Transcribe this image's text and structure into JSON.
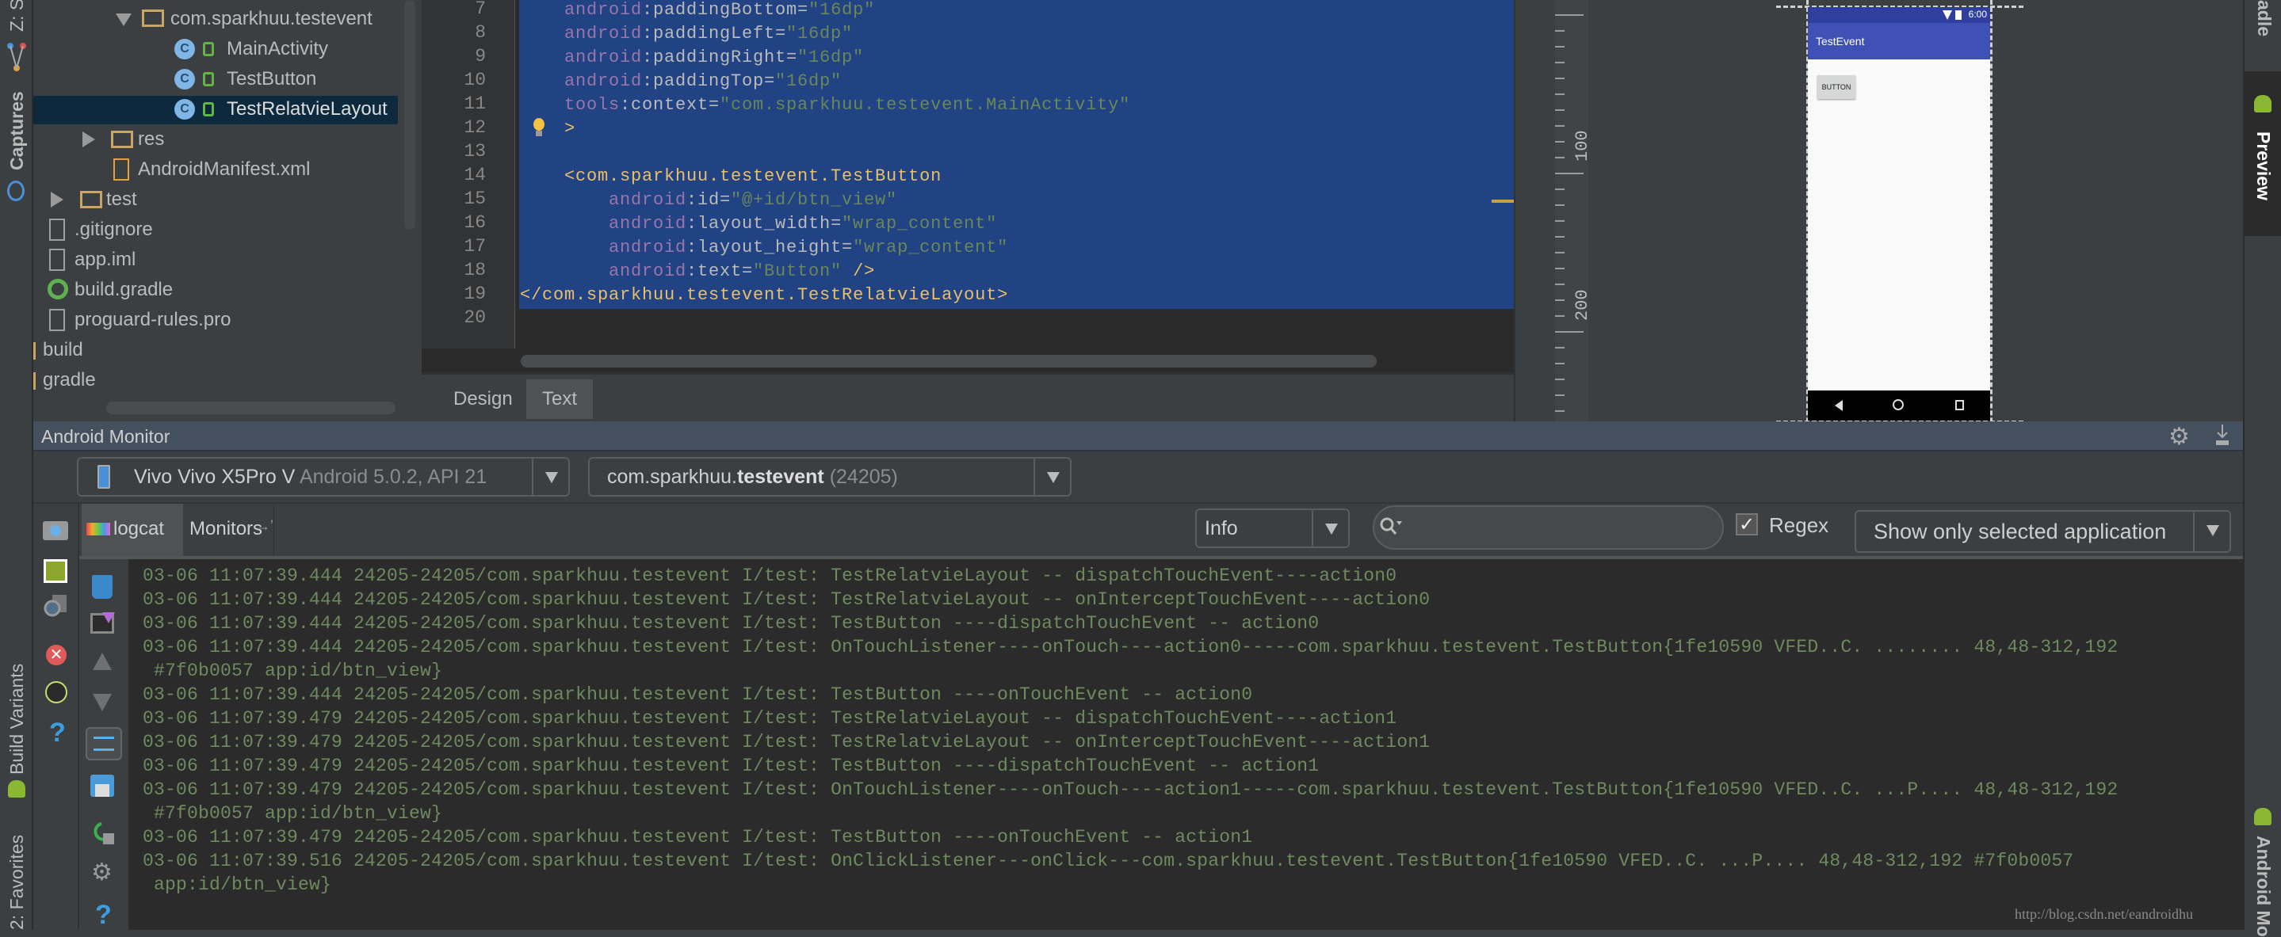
{
  "left_strip": {
    "structure_label": "Z: S",
    "captures_label": "Captures",
    "build_variants_label": "Build Variants",
    "favorites_label": "2: Favorites"
  },
  "project_tree": {
    "items": [
      {
        "label": "com.sparkhuu.testevent",
        "type": "package",
        "expanded": true
      },
      {
        "label": "MainActivity",
        "type": "class"
      },
      {
        "label": "TestButton",
        "type": "class"
      },
      {
        "label": "TestRelatvieLayout",
        "type": "class",
        "selected": true
      },
      {
        "label": "res",
        "type": "folder",
        "expanded": false
      },
      {
        "label": "AndroidManifest.xml",
        "type": "manifest"
      },
      {
        "label": "test",
        "type": "folder",
        "expanded": false
      },
      {
        "label": ".gitignore",
        "type": "file"
      },
      {
        "label": "app.iml",
        "type": "file"
      },
      {
        "label": "build.gradle",
        "type": "gradle"
      },
      {
        "label": "proguard-rules.pro",
        "type": "file"
      },
      {
        "label": "build",
        "type": "folder"
      },
      {
        "label": "gradle",
        "type": "folder"
      }
    ]
  },
  "editor": {
    "lines": [
      {
        "n": "7",
        "indent": 4,
        "parts": [
          [
            "ns",
            "android"
          ],
          [
            "",
            ":paddingBottom="
          ],
          [
            "val",
            "\"16dp\""
          ]
        ]
      },
      {
        "n": "8",
        "indent": 4,
        "parts": [
          [
            "ns",
            "android"
          ],
          [
            "",
            ":paddingLeft="
          ],
          [
            "val",
            "\"16dp\""
          ]
        ]
      },
      {
        "n": "9",
        "indent": 4,
        "parts": [
          [
            "ns",
            "android"
          ],
          [
            "",
            ":paddingRight="
          ],
          [
            "val",
            "\"16dp\""
          ]
        ]
      },
      {
        "n": "10",
        "indent": 4,
        "parts": [
          [
            "ns",
            "android"
          ],
          [
            "",
            ":paddingTop="
          ],
          [
            "val",
            "\"16dp\""
          ]
        ]
      },
      {
        "n": "11",
        "indent": 4,
        "parts": [
          [
            "ns",
            "tools"
          ],
          [
            "",
            ":context="
          ],
          [
            "val",
            "\"com.sparkhuu.testevent.MainActivity\""
          ]
        ]
      },
      {
        "n": "12",
        "indent": 4,
        "parts": [
          [
            "tag",
            ">"
          ]
        ]
      },
      {
        "n": "13",
        "indent": 0,
        "parts": []
      },
      {
        "n": "14",
        "indent": 4,
        "parts": [
          [
            "tag",
            "<com.sparkhuu.testevent.TestButton"
          ]
        ]
      },
      {
        "n": "15",
        "indent": 8,
        "parts": [
          [
            "ns",
            "android"
          ],
          [
            "",
            ":id="
          ],
          [
            "val",
            "\"@+id/btn_view\""
          ]
        ]
      },
      {
        "n": "16",
        "indent": 8,
        "parts": [
          [
            "ns",
            "android"
          ],
          [
            "",
            ":layout_width="
          ],
          [
            "val",
            "\"wrap_content\""
          ]
        ]
      },
      {
        "n": "17",
        "indent": 8,
        "parts": [
          [
            "ns",
            "android"
          ],
          [
            "",
            ":layout_height="
          ],
          [
            "val",
            "\"wrap_content\""
          ]
        ]
      },
      {
        "n": "18",
        "indent": 8,
        "parts": [
          [
            "ns",
            "android"
          ],
          [
            "",
            ":text="
          ],
          [
            "val",
            "\"Button\""
          ],
          [
            "tag",
            " />"
          ]
        ]
      },
      {
        "n": "19",
        "indent": 0,
        "parts": [
          [
            "tag",
            "</com.sparkhuu.testevent.TestRelatvieLayout>"
          ]
        ]
      },
      {
        "n": "20",
        "indent": 0,
        "parts": []
      }
    ],
    "tabs": [
      {
        "label": "Design",
        "active": false
      },
      {
        "label": "Text",
        "active": true
      }
    ]
  },
  "preview": {
    "ruler_labels": [
      "100",
      "200"
    ],
    "phone": {
      "status_time": "6:00",
      "app_title": "TestEvent",
      "button_label": "BUTTON"
    }
  },
  "right_strip": {
    "gradle_label": "adle",
    "preview_label": "Preview",
    "android_monitor_label": "Android Mo"
  },
  "monitor": {
    "title": "Android Monitor",
    "device": {
      "name": "Vivo Vivo X5Pro V",
      "detail": "Android 5.0.2, API 21"
    },
    "process": {
      "prefix": "com.sparkhuu.",
      "bold": "testevent",
      "pid": "(24205)"
    },
    "tabs": [
      {
        "label": "logcat",
        "active": true
      },
      {
        "label": "Monitors",
        "suffix": "→ʼ"
      }
    ],
    "level": "Info",
    "search_value": "",
    "regex_label": "Regex",
    "regex_checked": true,
    "filter": "Show only selected application",
    "log_lines": [
      "03-06 11:07:39.444 24205-24205/com.sparkhuu.testevent I/test: TestRelatvieLayout -- dispatchTouchEvent----action0",
      "03-06 11:07:39.444 24205-24205/com.sparkhuu.testevent I/test: TestRelatvieLayout -- onInterceptTouchEvent----action0",
      "03-06 11:07:39.444 24205-24205/com.sparkhuu.testevent I/test: TestButton ----dispatchTouchEvent -- action0",
      "03-06 11:07:39.444 24205-24205/com.sparkhuu.testevent I/test: OnTouchListener----onTouch----action0-----com.sparkhuu.testevent.TestButton{1fe10590 VFED..C. ........ 48,48-312,192",
      " #7f0b0057 app:id/btn_view}",
      "03-06 11:07:39.444 24205-24205/com.sparkhuu.testevent I/test: TestButton ----onTouchEvent -- action0",
      "03-06 11:07:39.479 24205-24205/com.sparkhuu.testevent I/test: TestRelatvieLayout -- dispatchTouchEvent----action1",
      "03-06 11:07:39.479 24205-24205/com.sparkhuu.testevent I/test: TestRelatvieLayout -- onInterceptTouchEvent----action1",
      "03-06 11:07:39.479 24205-24205/com.sparkhuu.testevent I/test: TestButton ----dispatchTouchEvent -- action1",
      "03-06 11:07:39.479 24205-24205/com.sparkhuu.testevent I/test: OnTouchListener----onTouch----action1-----com.sparkhuu.testevent.TestButton{1fe10590 VFED..C. ...P.... 48,48-312,192",
      " #7f0b0057 app:id/btn_view}",
      "03-06 11:07:39.479 24205-24205/com.sparkhuu.testevent I/test: TestButton ----onTouchEvent -- action1",
      "03-06 11:07:39.516 24205-24205/com.sparkhuu.testevent I/test: OnClickListener---onClick---com.sparkhuu.testevent.TestButton{1fe10590 VFED..C. ...P.... 48,48-312,192 #7f0b0057",
      " app:id/btn_view}"
    ]
  },
  "watermark": "http://blog.csdn.net/eandroidhu",
  "colors": {
    "selection": "#214283",
    "log_text": "#6f8a5e",
    "app_bar": "#3f51b5",
    "tree_selected": "#0d293e"
  }
}
